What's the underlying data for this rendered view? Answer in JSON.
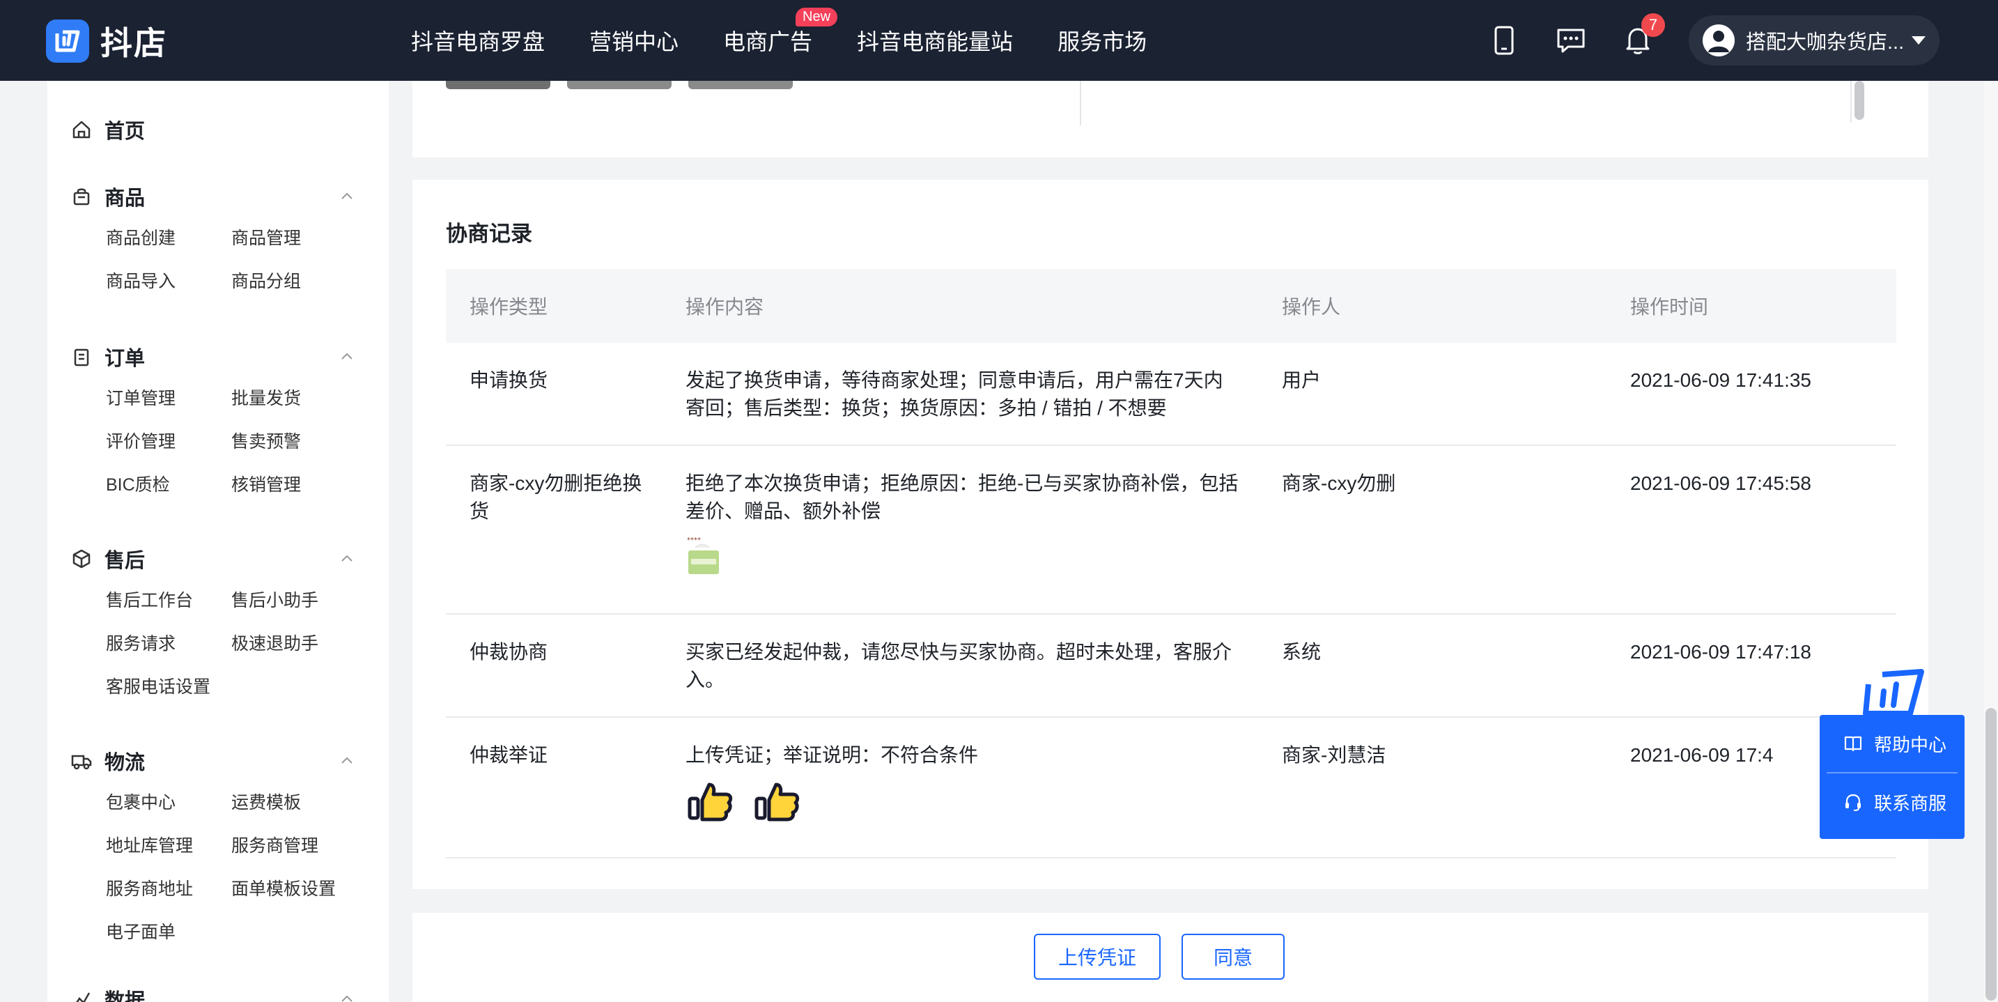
{
  "app": {
    "logo_text": "抖店"
  },
  "topnav": {
    "items": [
      {
        "label": "抖音电商罗盘"
      },
      {
        "label": "营销中心"
      },
      {
        "label": "电商广告",
        "badge": "New"
      },
      {
        "label": "抖音电商能量站"
      },
      {
        "label": "服务市场"
      }
    ],
    "icons": [
      "phone-icon",
      "message-icon",
      "bell-icon"
    ],
    "notification_count": "7",
    "user_name": "搭配大咖杂货店..."
  },
  "sidebar": {
    "home": "首页",
    "sections": [
      {
        "title": "商品",
        "icon": "bag-icon",
        "items": [
          "商品创建",
          "商品管理",
          "商品导入",
          "商品分组"
        ]
      },
      {
        "title": "订单",
        "icon": "clipboard-icon",
        "items": [
          "订单管理",
          "批量发货",
          "评价管理",
          "售卖预警",
          "BIC质检",
          "核销管理"
        ]
      },
      {
        "title": "售后",
        "icon": "box-icon",
        "items": [
          "售后工作台",
          "售后小助手",
          "服务请求",
          "极速退助手",
          "客服电话设置"
        ]
      },
      {
        "title": "物流",
        "icon": "truck-icon",
        "items": [
          "包裹中心",
          "运费模板",
          "地址库管理",
          "服务商管理",
          "服务商地址",
          "面单模板设置",
          "电子面单"
        ]
      },
      {
        "title": "数据",
        "icon": "chart-icon",
        "items": []
      }
    ]
  },
  "records": {
    "title": "协商记录",
    "columns": [
      "操作类型",
      "操作内容",
      "操作人",
      "操作时间"
    ],
    "rows": [
      {
        "type": "申请换货",
        "content": "发起了换货申请，等待商家处理；同意申请后，用户需在7天内寄回；售后类型：换货；换货原因：多拍 / 错拍 / 不想要",
        "operator": "用户",
        "time": "2021-06-09 17:41:35"
      },
      {
        "type": "商家-cxy勿删拒绝换货",
        "content": "拒绝了本次换货申请；拒绝原因：拒绝-已与买家协商补偿，包括差价、赠品、额外补偿",
        "operator": "商家-cxy勿删",
        "time": "2021-06-09 17:45:58",
        "attachment": "tissue-image"
      },
      {
        "type": "仲裁协商",
        "content": "买家已经发起仲裁，请您尽快与买家协商。超时未处理，客服介入。",
        "operator": "系统",
        "time": "2021-06-09 17:47:18"
      },
      {
        "type": "仲裁举证",
        "content": "上传凭证；举证说明：不符合条件",
        "operator": "商家-刘慧洁",
        "time": "2021-06-09 17:4",
        "attachments": [
          "thumbs-up-image",
          "thumbs-up-image"
        ]
      }
    ]
  },
  "actions": {
    "upload_label": "上传凭证",
    "agree_label": "同意"
  },
  "help": {
    "help_center": "帮助中心",
    "contact": "联系商服"
  },
  "colors": {
    "nav_bg": "#1b2232",
    "brand_blue": "#1966ff",
    "badge_red": "#f0494d"
  }
}
